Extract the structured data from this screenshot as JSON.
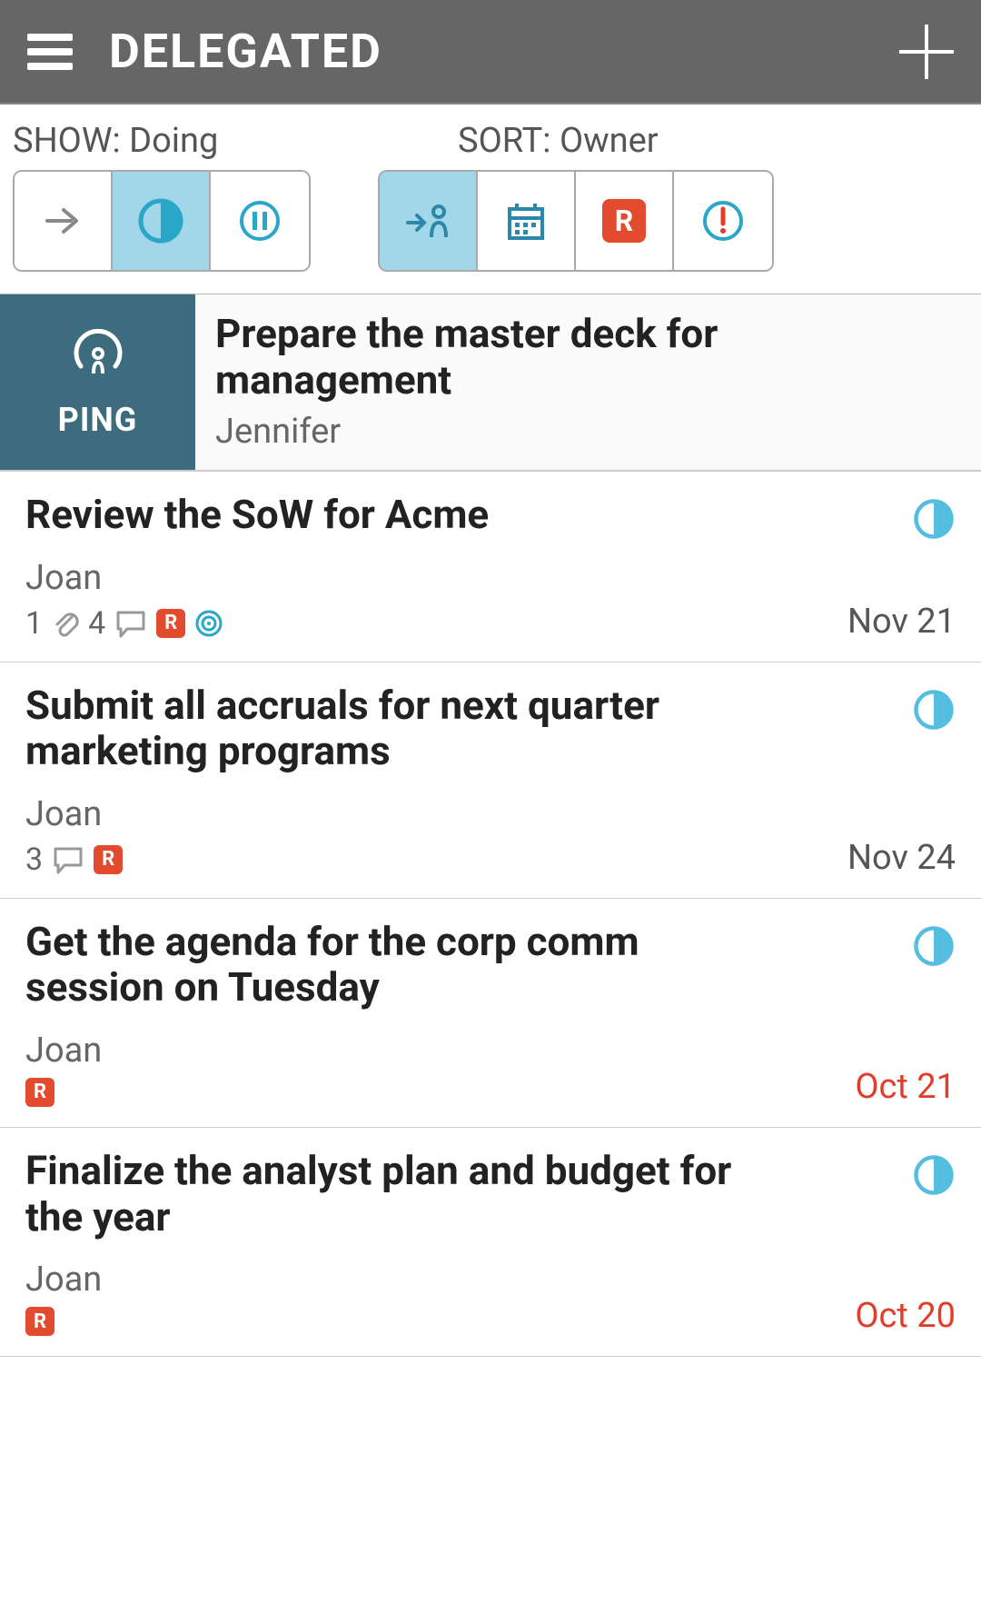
{
  "header": {
    "title": "DELEGATED"
  },
  "filters": {
    "show_label": "SHOW: Doing",
    "sort_label": "SORT: Owner",
    "show_options": [
      "arrow",
      "half-circle",
      "pause"
    ],
    "show_active_index": 1,
    "sort_options": [
      "owner",
      "calendar",
      "r-badge",
      "priority"
    ],
    "sort_active_index": 0
  },
  "pinned": {
    "ping_label": "PING",
    "title": "Prepare the master deck for management",
    "owner": "Jennifer"
  },
  "tasks": [
    {
      "title": "Review the SoW for Acme",
      "owner": "Joan",
      "attachments": 1,
      "comments": 4,
      "has_r": true,
      "has_target": true,
      "date": "Nov 21",
      "overdue": false
    },
    {
      "title": "Submit all accruals for next quarter marketing programs",
      "owner": "Joan",
      "attachments": 0,
      "comments": 3,
      "has_r": true,
      "has_target": false,
      "date": "Nov 24",
      "overdue": false
    },
    {
      "title": "Get the agenda for the corp comm session on Tuesday",
      "owner": "Joan",
      "attachments": 0,
      "comments": 0,
      "has_r": true,
      "has_target": false,
      "date": "Oct 21",
      "overdue": true
    },
    {
      "title": "Finalize the analyst plan and budget for the year",
      "owner": "Joan",
      "attachments": 0,
      "comments": 0,
      "has_r": true,
      "has_target": false,
      "date": "Oct 20",
      "overdue": true
    }
  ]
}
